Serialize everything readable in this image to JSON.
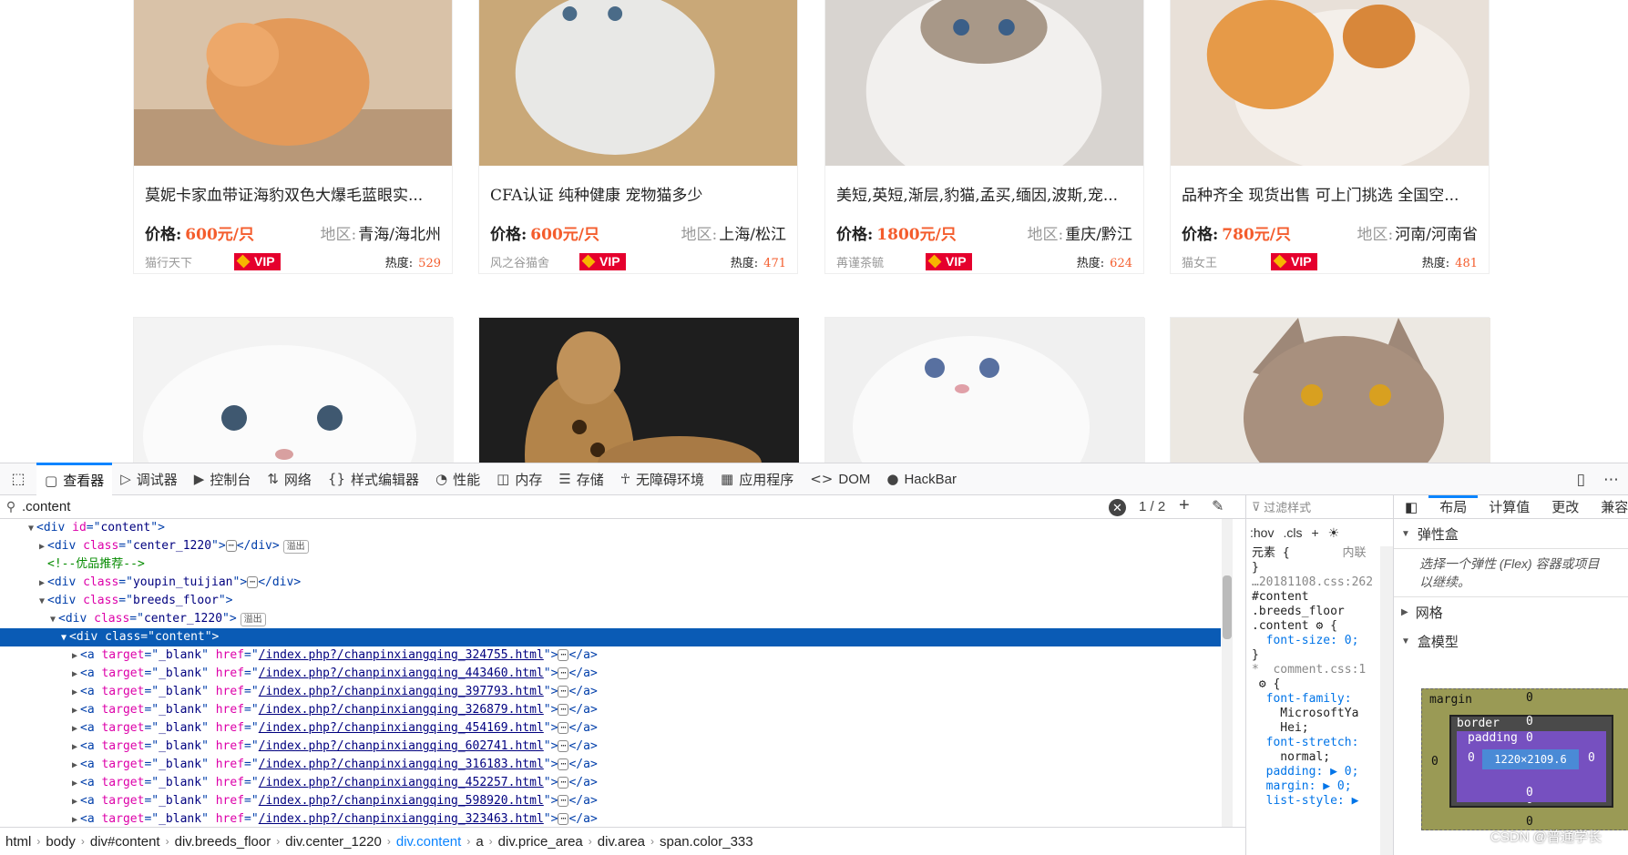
{
  "cards_row1": [
    {
      "title": "莫妮卡家血带证海豹双色大爆毛蓝眼实...",
      "price_label": "价格:",
      "price": "600元/只",
      "region_label": "地区:",
      "region": "青海/海北州",
      "seller": "猫行天下",
      "vip": "VIP",
      "heat_label": "热度:",
      "heat": "529"
    },
    {
      "title": "CFA认证 纯种健康 宠物猫多少",
      "price_label": "价格:",
      "price": "600元/只",
      "region_label": "地区:",
      "region": "上海/松江",
      "seller": "风之谷猫舍",
      "vip": "VIP",
      "heat_label": "热度:",
      "heat": "471"
    },
    {
      "title": "美短,英短,渐层,豹猫,孟买,缅因,波斯,宠...",
      "price_label": "价格:",
      "price": "1800元/只",
      "region_label": "地区:",
      "region": "重庆/黔江",
      "seller": "苒谨茶毓",
      "vip": "VIP",
      "heat_label": "热度:",
      "heat": "624"
    },
    {
      "title": "品种齐全 现货出售 可上门挑选 全国空...",
      "price_label": "价格:",
      "price": "780元/只",
      "region_label": "地区:",
      "region": "河南/河南省",
      "seller": "猫女王",
      "vip": "VIP",
      "heat_label": "热度:",
      "heat": "481"
    }
  ],
  "toolbar": {
    "tools": [
      {
        "icon": "▢",
        "label": "查看器",
        "name": "tab-inspector",
        "active": true
      },
      {
        "icon": "▷",
        "label": "调试器",
        "name": "tab-debugger"
      },
      {
        "icon": "▶",
        "label": "控制台",
        "name": "tab-console"
      },
      {
        "icon": "⇅",
        "label": "网络",
        "name": "tab-network"
      },
      {
        "icon": "{}",
        "label": "样式编辑器",
        "name": "tab-style-editor"
      },
      {
        "icon": "◔",
        "label": "性能",
        "name": "tab-performance"
      },
      {
        "icon": "◫",
        "label": "内存",
        "name": "tab-memory"
      },
      {
        "icon": "☰",
        "label": "存储",
        "name": "tab-storage"
      },
      {
        "icon": "☥",
        "label": "无障碍环境",
        "name": "tab-accessibility"
      },
      {
        "icon": "▦",
        "label": "应用程序",
        "name": "tab-application"
      },
      {
        "icon": "<>",
        "label": "DOM",
        "name": "tab-dom"
      },
      {
        "icon": "●",
        "label": "HackBar",
        "name": "tab-hackbar"
      }
    ]
  },
  "search": {
    "value": ".content",
    "count": "1 / 2"
  },
  "tree": [
    {
      "indent": 2,
      "tw": "▼",
      "parts": [
        [
          "tag",
          "<div "
        ],
        [
          "attr",
          "id"
        ],
        [
          "tag",
          "=\""
        ],
        [
          "val",
          "content"
        ],
        [
          "tag",
          "\">"
        ]
      ]
    },
    {
      "indent": 3,
      "tw": "▶",
      "parts": [
        [
          "tag",
          "<div "
        ],
        [
          "attr",
          "class"
        ],
        [
          "tag",
          "=\""
        ],
        [
          "val",
          "center_1220"
        ],
        [
          "tag",
          "\">"
        ],
        [
          "dots",
          "⋯"
        ],
        [
          "tag",
          "</div>"
        ],
        [
          "badge",
          "溢出"
        ]
      ]
    },
    {
      "indent": 3,
      "tw": "",
      "parts": [
        [
          "cmt",
          "<!--优品推荐-->"
        ]
      ]
    },
    {
      "indent": 3,
      "tw": "▶",
      "parts": [
        [
          "tag",
          "<div "
        ],
        [
          "attr",
          "class"
        ],
        [
          "tag",
          "=\""
        ],
        [
          "val",
          "youpin_tuijian"
        ],
        [
          "tag",
          "\">"
        ],
        [
          "dots",
          "⋯"
        ],
        [
          "tag",
          "</div>"
        ]
      ]
    },
    {
      "indent": 3,
      "tw": "▼",
      "parts": [
        [
          "tag",
          "<div "
        ],
        [
          "attr",
          "class"
        ],
        [
          "tag",
          "=\""
        ],
        [
          "val",
          "breeds_floor"
        ],
        [
          "tag",
          "\">"
        ]
      ]
    },
    {
      "indent": 4,
      "tw": "▼",
      "parts": [
        [
          "tag",
          "<div "
        ],
        [
          "attr",
          "class"
        ],
        [
          "tag",
          "=\""
        ],
        [
          "val",
          "center_1220"
        ],
        [
          "tag",
          "\">"
        ],
        [
          "badge",
          "溢出"
        ]
      ]
    },
    {
      "indent": 5,
      "tw": "▼",
      "sel": true,
      "parts": [
        [
          "tag",
          "<div "
        ],
        [
          "attr",
          "class"
        ],
        [
          "tag",
          "=\""
        ],
        [
          "val",
          "content"
        ],
        [
          "tag",
          "\">"
        ]
      ]
    },
    {
      "indent": 6,
      "tw": "▶",
      "href": "/index.php?/chanpinxiangqing_324755.html"
    },
    {
      "indent": 6,
      "tw": "▶",
      "href": "/index.php?/chanpinxiangqing_443460.html"
    },
    {
      "indent": 6,
      "tw": "▶",
      "href": "/index.php?/chanpinxiangqing_397793.html"
    },
    {
      "indent": 6,
      "tw": "▶",
      "href": "/index.php?/chanpinxiangqing_326879.html"
    },
    {
      "indent": 6,
      "tw": "▶",
      "href": "/index.php?/chanpinxiangqing_454169.html"
    },
    {
      "indent": 6,
      "tw": "▶",
      "href": "/index.php?/chanpinxiangqing_602741.html"
    },
    {
      "indent": 6,
      "tw": "▶",
      "href": "/index.php?/chanpinxiangqing_316183.html"
    },
    {
      "indent": 6,
      "tw": "▶",
      "href": "/index.php?/chanpinxiangqing_452257.html"
    },
    {
      "indent": 6,
      "tw": "▶",
      "href": "/index.php?/chanpinxiangqing_598920.html"
    },
    {
      "indent": 6,
      "tw": "▶",
      "href": "/index.php?/chanpinxiangqing_323463.html"
    }
  ],
  "breadcrumbs": [
    "html",
    "body",
    "div#content",
    "div.breeds_floor",
    "div.center_1220",
    "div.content",
    "a",
    "div.price_area",
    "div.area",
    "span.color_333"
  ],
  "breadcrumb_current": "div.content",
  "rules": {
    "filter_placeholder": "过滤样式",
    "hov": ":hov",
    "cls": ".cls",
    "element_label": "元素",
    "inline_label": "内联",
    "lines": [
      {
        "cls": "",
        "t": "}"
      },
      {
        "cls": "dim",
        "t": "…20181108.css:262"
      },
      {
        "cls": "",
        "t": "#content"
      },
      {
        "cls": "",
        "t": ".breeds_floor"
      },
      {
        "cls": "",
        "t": ".content ⚙ {"
      },
      {
        "cls": "prop",
        "t": "  font-size: 0;"
      },
      {
        "cls": "",
        "t": "}"
      },
      {
        "cls": "dim",
        "t": "*  comment.css:1"
      },
      {
        "cls": "",
        "t": " ⚙ {"
      },
      {
        "cls": "prop",
        "t": "  font-family:"
      },
      {
        "cls": "",
        "t": "    MicrosoftYa"
      },
      {
        "cls": "",
        "t": "    Hei;"
      },
      {
        "cls": "prop",
        "t": "  font-stretch:"
      },
      {
        "cls": "",
        "t": "    normal;"
      },
      {
        "cls": "prop",
        "t": "  padding: ▶ 0;"
      },
      {
        "cls": "prop",
        "t": "  margin: ▶ 0;"
      },
      {
        "cls": "prop",
        "t": "  list-style: ▶"
      }
    ]
  },
  "layout": {
    "tabs": [
      "布局",
      "计算值",
      "更改",
      "兼容"
    ],
    "flex_title": "弹性盒",
    "flex_note": "选择一个弹性 (Flex) 容器或项目以继续。",
    "grid_title": "网格",
    "boxmodel_title": "盒模型",
    "margin_label": "margin",
    "border_label": "border",
    "padding_label": "padding",
    "content_size": "1220×2109.6",
    "zero": "0"
  },
  "watermark": "CSDN @普通学长"
}
